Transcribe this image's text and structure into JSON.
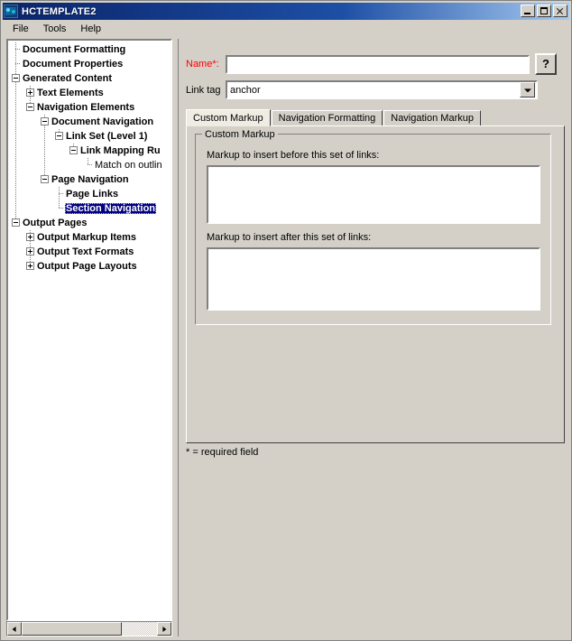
{
  "window": {
    "title": "HCTEMPLATE2",
    "app_icon": "app-icon",
    "buttons": {
      "minimize": "minimize-button",
      "maximize": "maximize-button",
      "close": "close-button"
    }
  },
  "menubar": {
    "items": [
      {
        "label": "File"
      },
      {
        "label": "Tools"
      },
      {
        "label": "Help"
      }
    ]
  },
  "tree": {
    "nodes": [
      {
        "label": "Document Formatting",
        "depth": 0,
        "toggle": "none",
        "selected": false,
        "bold": true
      },
      {
        "label": "Document Properties",
        "depth": 0,
        "toggle": "none",
        "selected": false,
        "bold": true
      },
      {
        "label": "Generated Content",
        "depth": 0,
        "toggle": "expanded",
        "selected": false,
        "bold": true
      },
      {
        "label": "Text Elements",
        "depth": 1,
        "toggle": "collapsed",
        "selected": false,
        "bold": true
      },
      {
        "label": "Navigation Elements",
        "depth": 1,
        "toggle": "expanded",
        "selected": false,
        "bold": true
      },
      {
        "label": "Document Navigation",
        "depth": 2,
        "toggle": "expanded",
        "selected": false,
        "bold": true
      },
      {
        "label": "Link Set (Level 1)",
        "depth": 3,
        "toggle": "expanded",
        "selected": false,
        "bold": true
      },
      {
        "label": "Link Mapping Ru",
        "depth": 4,
        "toggle": "expanded",
        "selected": false,
        "bold": true
      },
      {
        "label": "Match on outlin",
        "depth": 5,
        "toggle": "none",
        "selected": false,
        "bold": false
      },
      {
        "label": "Page Navigation",
        "depth": 2,
        "toggle": "expanded",
        "selected": false,
        "bold": true
      },
      {
        "label": "Page Links",
        "depth": 3,
        "toggle": "none",
        "selected": false,
        "bold": true
      },
      {
        "label": "Section Navigation",
        "depth": 3,
        "toggle": "none",
        "selected": true,
        "bold": true
      },
      {
        "label": "Output Pages",
        "depth": 0,
        "toggle": "expanded",
        "selected": false,
        "bold": true
      },
      {
        "label": "Output Markup Items",
        "depth": 1,
        "toggle": "collapsed",
        "selected": false,
        "bold": true
      },
      {
        "label": "Output Text Formats",
        "depth": 1,
        "toggle": "collapsed",
        "selected": false,
        "bold": true
      },
      {
        "label": "Output Page Layouts",
        "depth": 1,
        "toggle": "collapsed",
        "selected": false,
        "bold": true
      }
    ],
    "scrollbar": {
      "left_arrow": "scroll-left",
      "right_arrow": "scroll-right",
      "thumb_position_pct": 0,
      "thumb_width_pct": 74
    }
  },
  "form": {
    "name_label": "Name*:",
    "name_value": "",
    "name_placeholder": "",
    "help_button_label": "?",
    "linktag_label": "Link tag",
    "linktag_value": "anchor",
    "linktag_options": [
      "anchor"
    ]
  },
  "tabs": [
    {
      "label": "Custom Markup",
      "active": true
    },
    {
      "label": "Navigation Formatting",
      "active": false
    },
    {
      "label": "Navigation Markup",
      "active": false
    }
  ],
  "panel": {
    "group_title": "Custom Markup",
    "before_label": "Markup to insert before this set of links:",
    "before_value": "",
    "after_label": "Markup to insert after this set of links:",
    "after_value": ""
  },
  "footer": {
    "required_note": "* = required field"
  },
  "colors": {
    "face": "#d4d0c8",
    "title_active": "#0a246a",
    "selection": "#000080",
    "required": "#ff0000",
    "tab_active": "#efece4"
  }
}
